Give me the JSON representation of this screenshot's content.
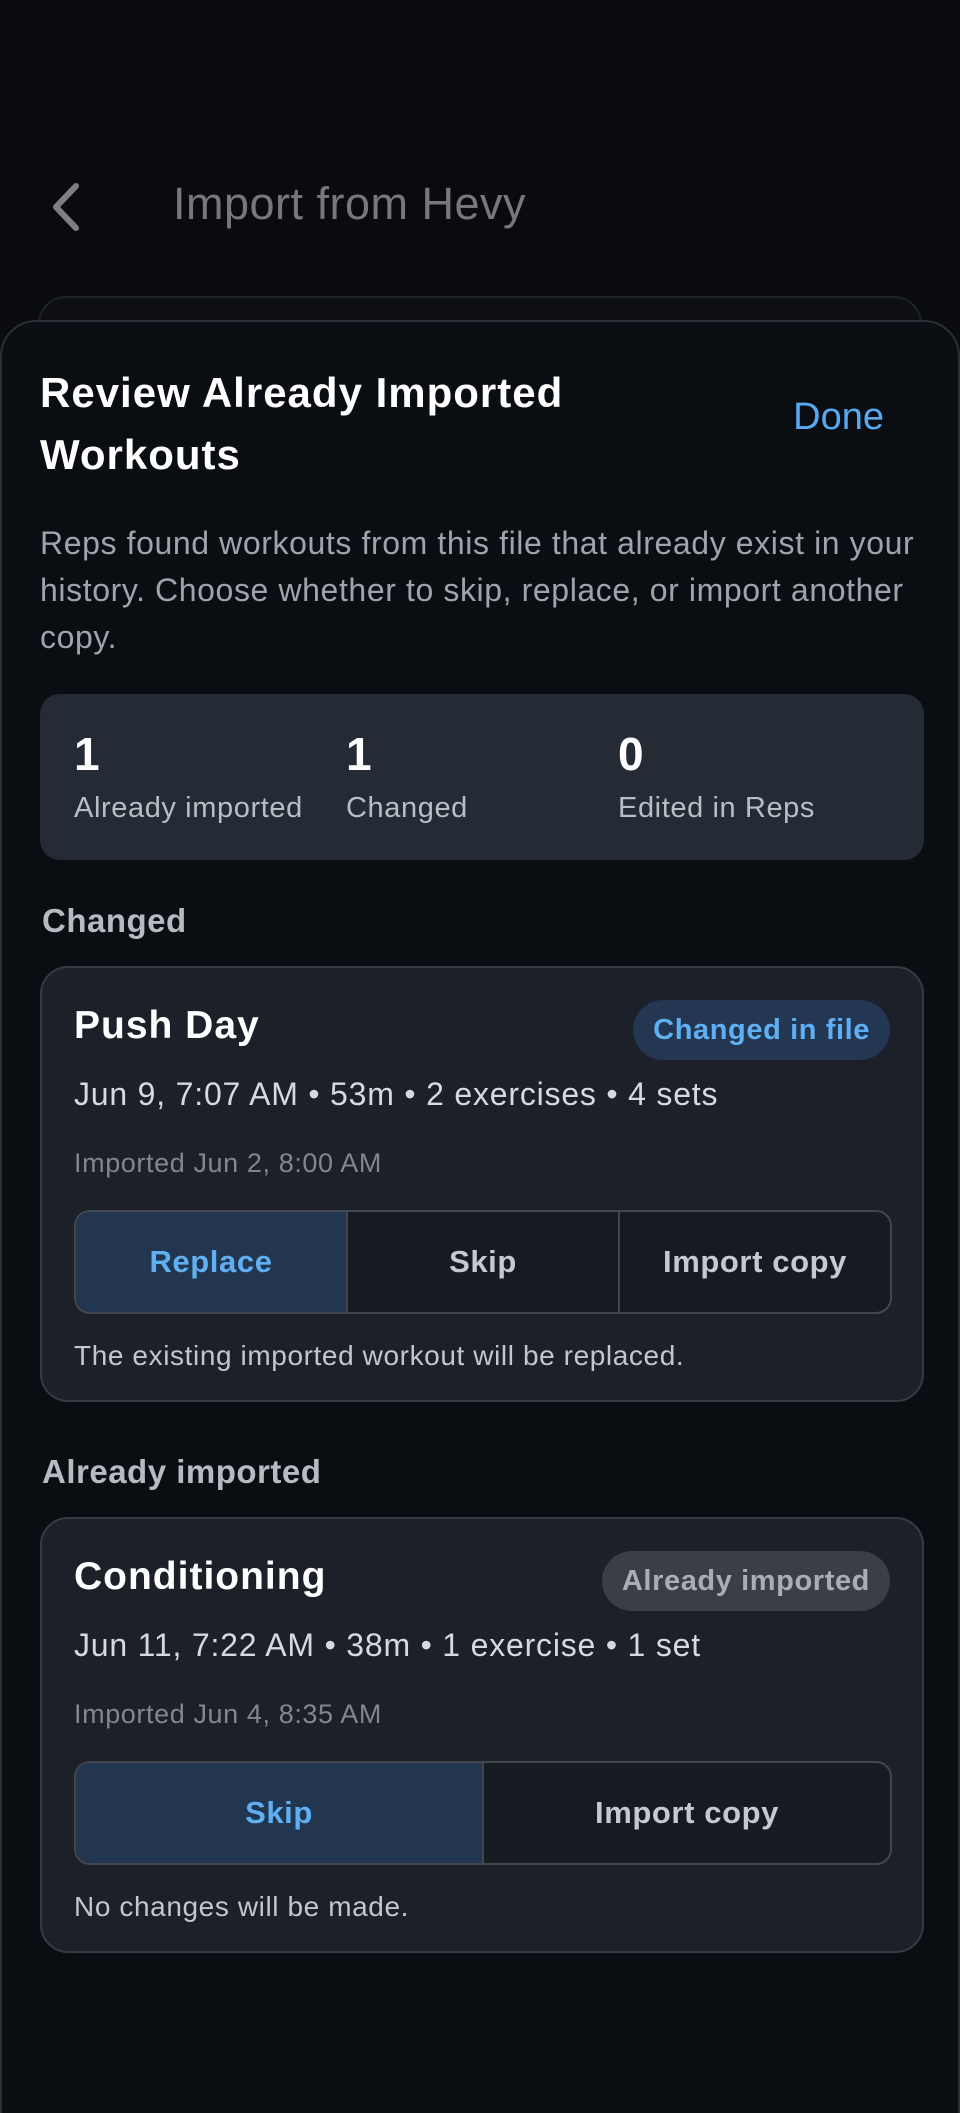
{
  "header": {
    "title": "Import from Hevy",
    "back_icon": "chevron-left-icon"
  },
  "sheet": {
    "title": "Review Already Imported Workouts",
    "done_label": "Done",
    "intro": "Reps found workouts from this file that already exist in your history. Choose whether to skip, replace, or import another copy."
  },
  "summary": {
    "stats": [
      {
        "value": "1",
        "label": "Already imported"
      },
      {
        "value": "1",
        "label": "Changed"
      },
      {
        "value": "0",
        "label": "Edited in Reps"
      }
    ]
  },
  "sections": [
    {
      "label": "Changed",
      "workout": {
        "name": "Push Day",
        "badge": "Changed in file",
        "meta": "Jun 9, 7:07 AM • 53m • 2 exercises • 4 sets",
        "imported": "Imported Jun 2, 8:00 AM",
        "options": [
          "Replace",
          "Skip",
          "Import copy"
        ],
        "selected": "Replace",
        "hint": "The existing imported workout will be replaced."
      }
    },
    {
      "label": "Already imported",
      "workout": {
        "name": "Conditioning",
        "badge": "Already imported",
        "meta": "Jun 11, 7:22 AM • 38m • 1 exercise • 1 set",
        "imported": "Imported Jun 4, 8:35 AM",
        "options": [
          "Skip",
          "Import copy"
        ],
        "selected": "Skip",
        "hint": "No changes will be made."
      }
    }
  ],
  "colors": {
    "accent": "#58a9f0",
    "sheet_bg": "#0a0d12",
    "card_bg": "#1b2029",
    "summary_bg": "#252b35"
  }
}
